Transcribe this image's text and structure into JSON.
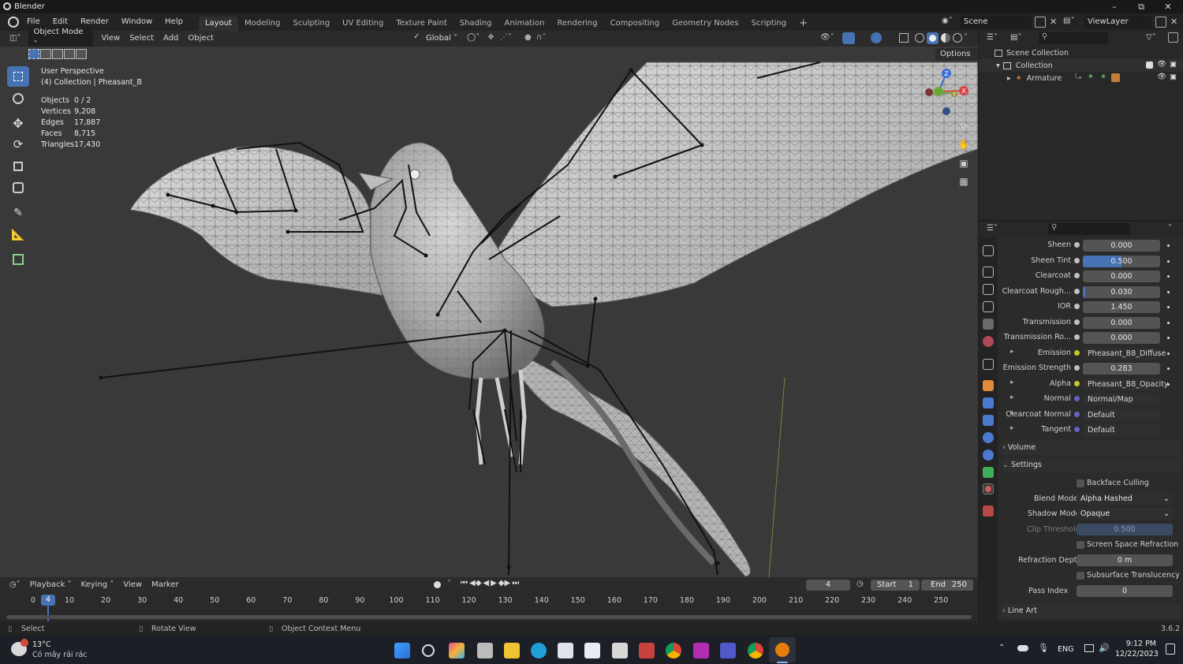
{
  "app": {
    "title": "Blender",
    "version": "3.6.2"
  },
  "menu": [
    "File",
    "Edit",
    "Render",
    "Window",
    "Help"
  ],
  "workspaces": [
    {
      "label": "Layout",
      "active": true
    },
    {
      "label": "Modeling"
    },
    {
      "label": "Sculpting"
    },
    {
      "label": "UV Editing"
    },
    {
      "label": "Texture Paint"
    },
    {
      "label": "Shading"
    },
    {
      "label": "Animation"
    },
    {
      "label": "Rendering"
    },
    {
      "label": "Compositing"
    },
    {
      "label": "Geometry Nodes"
    },
    {
      "label": "Scripting"
    }
  ],
  "scene": {
    "name": "Scene",
    "view_layer": "ViewLayer"
  },
  "viewport_header": {
    "mode": "Object Mode",
    "menus": [
      "View",
      "Select",
      "Add",
      "Object"
    ],
    "transform_orientation": "Global",
    "options_label": "Options"
  },
  "viewport": {
    "perspective": "User Perspective",
    "collection_line": "(4) Collection | Pheasant_B",
    "stats": [
      {
        "label": "Objects",
        "value": "0 / 2"
      },
      {
        "label": "Vertices",
        "value": "9,208"
      },
      {
        "label": "Edges",
        "value": "17,887"
      },
      {
        "label": "Faces",
        "value": "8,715"
      },
      {
        "label": "Triangles",
        "value": "17,430"
      }
    ],
    "gizmo": {
      "x": "X",
      "y": "Y",
      "z": "Z"
    }
  },
  "outliner": {
    "root": "Scene Collection",
    "collection": "Collection",
    "object": "Armature"
  },
  "properties": {
    "rows": [
      {
        "label": "Sheen",
        "value": "0.000"
      },
      {
        "label": "Sheen Tint",
        "value": "0.500",
        "fill": 0.5
      },
      {
        "label": "Clearcoat",
        "value": "0.000"
      },
      {
        "label": "Clearcoat Rough...",
        "value": "0.030",
        "fill": 0.03
      },
      {
        "label": "IOR",
        "value": "1.450"
      },
      {
        "label": "Transmission",
        "value": "0.000"
      },
      {
        "label": "Transmission Ro...",
        "value": "0.000"
      },
      {
        "label": "Emission",
        "value": "Pheasant_B8_Diffuse",
        "link": true,
        "dot": "#c7c729"
      },
      {
        "label": "Emission Strength",
        "value": "0.283"
      },
      {
        "label": "Alpha",
        "value": "Pheasant_B8_Opacity",
        "link": true,
        "dot": "#c7c729"
      },
      {
        "label": "Normal",
        "value": "Normal/Map",
        "link": true,
        "dot": "#6363c7"
      },
      {
        "label": "Clearcoat Normal",
        "value": "Default",
        "link": true,
        "dot": "#6363c7"
      },
      {
        "label": "Tangent",
        "value": "Default",
        "link": true,
        "dot": "#6363c7"
      }
    ],
    "volume_label": "Volume",
    "settings_label": "Settings",
    "settings": {
      "backface_culling": "Backface Culling",
      "blend_mode_label": "Blend Mode",
      "blend_mode": "Alpha Hashed",
      "shadow_mode_label": "Shadow Mode",
      "shadow_mode": "Opaque",
      "clip_threshold_label": "Clip Threshold",
      "clip_threshold": "0.500",
      "ssr": "Screen Space Refraction",
      "refraction_depth_label": "Refraction Depth",
      "refraction_depth": "0 m",
      "sss": "Subsurface Translucency",
      "pass_index_label": "Pass Index",
      "pass_index": "0"
    },
    "line_art_label": "Line Art"
  },
  "timeline": {
    "menus": [
      "Playback",
      "Keying",
      "View",
      "Marker"
    ],
    "current_frame": "4",
    "start_label": "Start",
    "start": "1",
    "end_label": "End",
    "end": "250",
    "ticks": [
      "0",
      "10",
      "20",
      "30",
      "40",
      "50",
      "60",
      "70",
      "80",
      "90",
      "100",
      "110",
      "120",
      "130",
      "140",
      "150",
      "160",
      "170",
      "180",
      "190",
      "200",
      "210",
      "220",
      "230",
      "240",
      "250"
    ]
  },
  "statusbar": {
    "select": "Select",
    "rotate": "Rotate View",
    "context": "Object Context Menu"
  },
  "taskbar": {
    "weather_temp": "13°C",
    "weather_desc": "Có mây rải rác",
    "lang": "ENG",
    "time": "9:12 PM",
    "date": "12/22/2023"
  }
}
